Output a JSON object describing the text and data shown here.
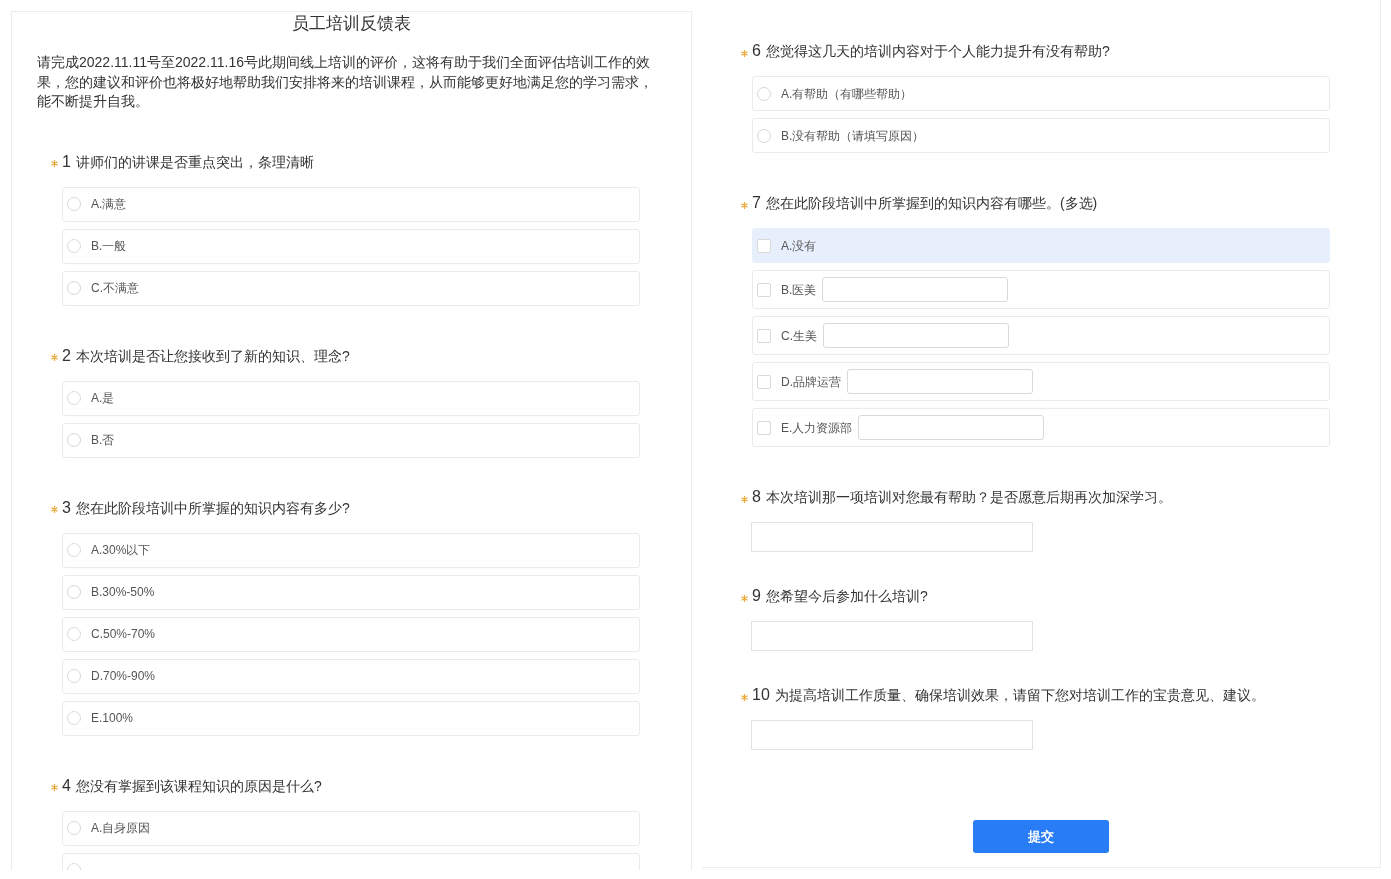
{
  "left_panel": {
    "title": "员工培训反馈表",
    "description": "请完成2022.11.11号至2022.11.16号此期间线上培训的评价，这将有助于我们全面评估培训工作的效果，您的建议和评价也将极好地帮助我们安排将来的培训课程，从而能够更好地满足您的学习需求，能不断提升自我。",
    "questions": [
      {
        "number": "1",
        "required": true,
        "title": "讲师们的讲课是否重点突出，条理清晰",
        "kind": "single",
        "options": [
          {
            "label": "A.满意",
            "selected": false
          },
          {
            "label": "B.一般",
            "selected": false
          },
          {
            "label": "C.不满意",
            "selected": false
          }
        ]
      },
      {
        "number": "2",
        "required": true,
        "title": "本次培训是否让您接收到了新的知识、理念?",
        "kind": "single",
        "options": [
          {
            "label": "A.是",
            "selected": false
          },
          {
            "label": "B.否",
            "selected": false
          }
        ]
      },
      {
        "number": "3",
        "required": true,
        "title": "您在此阶段培训中所掌握的知识内容有多少?",
        "kind": "single",
        "options": [
          {
            "label": "A.30%以下",
            "selected": false
          },
          {
            "label": "B.30%-50%",
            "selected": false
          },
          {
            "label": "C.50%-70%",
            "selected": false
          },
          {
            "label": "D.70%-90%",
            "selected": false
          },
          {
            "label": "E.100%",
            "selected": false
          }
        ]
      },
      {
        "number": "4",
        "required": true,
        "title": "您没有掌握到该课程知识的原因是什么?",
        "kind": "single",
        "options": [
          {
            "label": "A.自身原因",
            "selected": false
          },
          {
            "selected": false
          }
        ]
      }
    ]
  },
  "right_panel": {
    "questions": [
      {
        "number": "6",
        "required": true,
        "title": "您觉得这几天的培训内容对于个人能力提升有没有帮助?",
        "kind": "single",
        "options": [
          {
            "label": "A.有帮助（有哪些帮助）",
            "selected": false
          },
          {
            "label": "B.没有帮助（请填写原因）",
            "selected": false
          }
        ]
      },
      {
        "number": "7",
        "required": true,
        "title": "您在此阶段培训中所掌握到的知识内容有哪些。(多选)",
        "kind": "multiple",
        "options": [
          {
            "label": "A.没有",
            "kind": "plain",
            "checked": false,
            "highlighted": true
          },
          {
            "label": "B.医美",
            "kind": "with_input",
            "checked": false,
            "highlighted": false
          },
          {
            "label": "C.生美",
            "kind": "with_input",
            "checked": false,
            "highlighted": false
          },
          {
            "label": "D.品牌运营",
            "kind": "with_input",
            "checked": false,
            "highlighted": false
          },
          {
            "label": "E.人力资源部",
            "kind": "with_input",
            "checked": false,
            "highlighted": false
          }
        ]
      },
      {
        "number": "8",
        "required": true,
        "title": "本次培训那一项培训对您最有帮助？是否愿意后期再次加深学习。",
        "kind": "text"
      },
      {
        "number": "9",
        "required": true,
        "title": "您希望今后参加什么培训?",
        "kind": "text"
      },
      {
        "number": "10",
        "required": true,
        "title": "为提高培训工作质量、确保培训效果，请留下您对培训工作的宝贵意见、建议。",
        "kind": "text"
      }
    ],
    "submit_button": {
      "label": "提交"
    }
  }
}
